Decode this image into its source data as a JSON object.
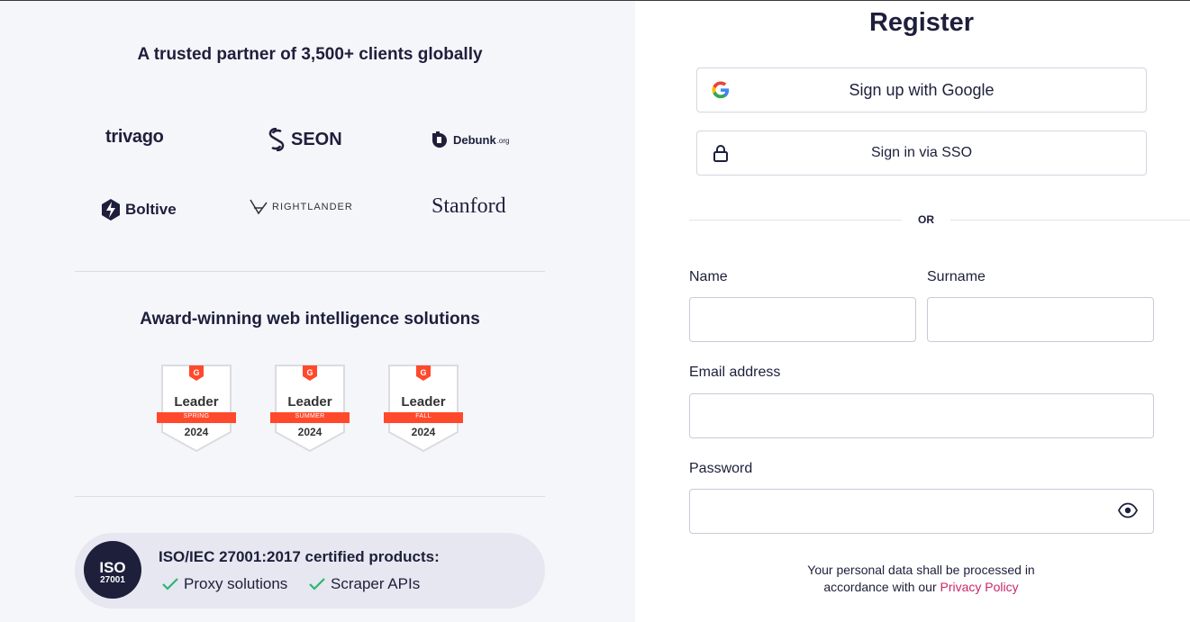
{
  "left": {
    "trusted_title": "A trusted partner of 3,500+ clients globally",
    "logos": {
      "trivago": "trivago",
      "seon": "SEON",
      "debunk": "Debunk",
      "debunk_suffix": ".org",
      "boltive": "Boltive",
      "rightlander": "RIGHTLANDER",
      "stanford": "Stanford"
    },
    "award_title": "Award-winning web intelligence solutions",
    "badges": [
      {
        "title": "Leader",
        "season": "SPRING",
        "year": "2024"
      },
      {
        "title": "Leader",
        "season": "SUMMER",
        "year": "2024"
      },
      {
        "title": "Leader",
        "season": "FALL",
        "year": "2024"
      }
    ],
    "iso": {
      "seal_main": "ISO",
      "seal_sub": "27001",
      "title": "ISO/IEC 27001:2017 certified products:",
      "items": [
        "Proxy solutions",
        "Scraper APIs"
      ]
    },
    "colors": {
      "badge_ribbon": "#ff492c",
      "check": "#2bb673"
    }
  },
  "right": {
    "title": "Register",
    "google_button": "Sign up with Google",
    "sso_button": "Sign in via SSO",
    "or_text": "OR",
    "name_label": "Name",
    "surname_label": "Surname",
    "email_label": "Email address",
    "password_label": "Password",
    "notice_text": "Your personal data shall be processed in accordance with our",
    "privacy_link": "Privacy Policy",
    "colors": {
      "link": "#cc2669",
      "text": "#1d1f3b"
    }
  }
}
